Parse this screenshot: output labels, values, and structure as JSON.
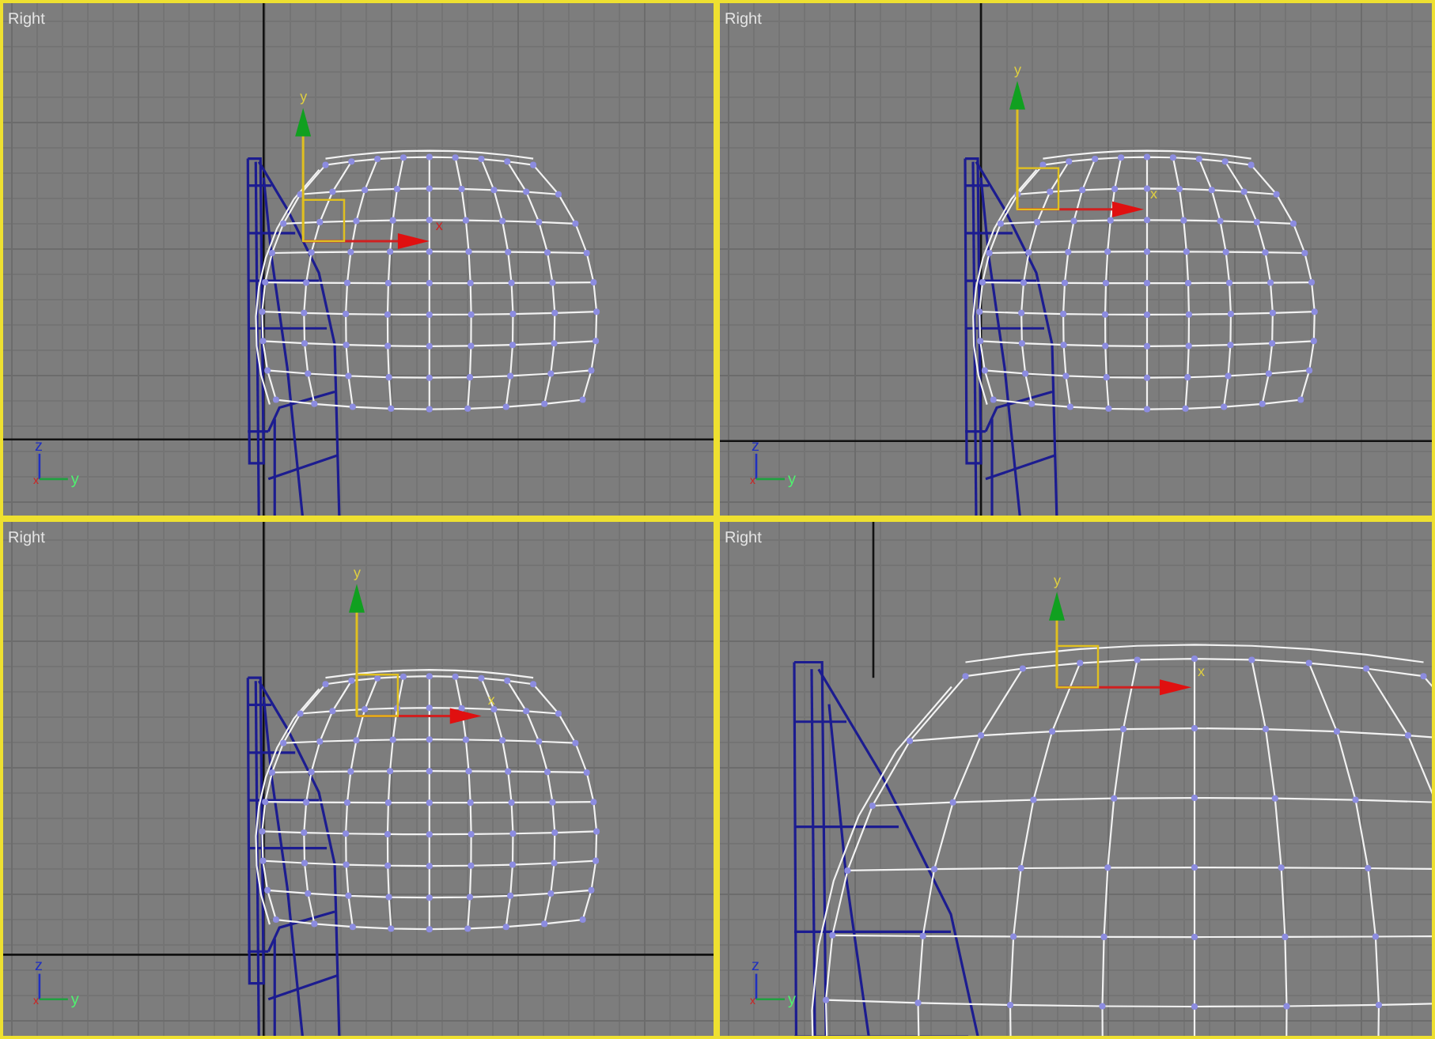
{
  "viewports": [
    {
      "label": "Right",
      "gizmo": {
        "x_label": "x",
        "y_label": "y"
      },
      "tripod": {
        "z": "z",
        "x": "x",
        "y": "y"
      }
    },
    {
      "label": "Right",
      "gizmo": {
        "x_label": "x",
        "y_label": "y"
      },
      "tripod": {
        "z": "z",
        "x": "x",
        "y": "y"
      }
    },
    {
      "label": "Right",
      "gizmo": {
        "x_label": "x",
        "y_label": "y"
      },
      "tripod": {
        "z": "z",
        "x": "x",
        "y": "y"
      }
    },
    {
      "label": "Right",
      "gizmo": {
        "x_label": "x",
        "y_label": "y"
      },
      "tripod": {
        "z": "z",
        "x": "x",
        "y": "y"
      }
    }
  ]
}
